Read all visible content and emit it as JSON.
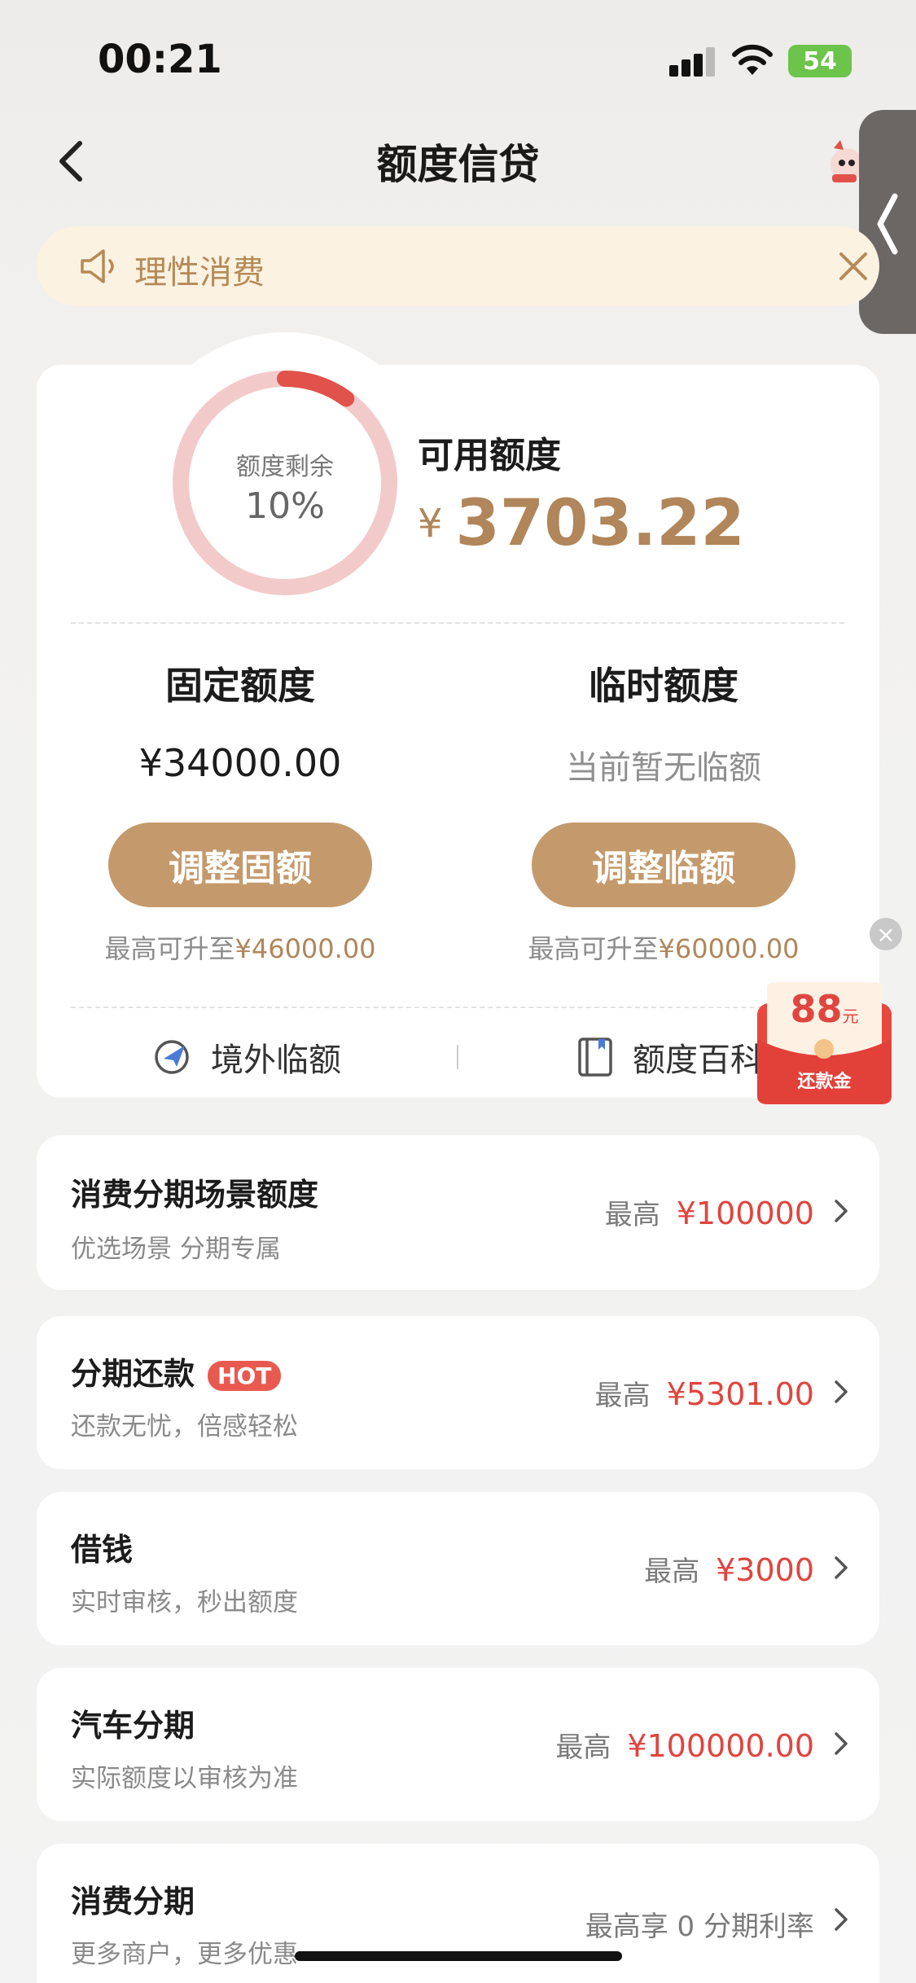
{
  "status_bar": {
    "time": "00:21",
    "battery": "54"
  },
  "nav": {
    "title": "额度信贷"
  },
  "notice": {
    "text": "理性消费"
  },
  "credit_card": {
    "ring_label": "额度剩余",
    "ring_value": "10%",
    "ring_fraction": 0.1,
    "available_label": "可用额度",
    "currency": "¥",
    "available_amount": "3703.22",
    "fixed": {
      "title": "固定额度",
      "value": "¥34000.00",
      "button": "调整固额",
      "hint_prefix": "最高可升至",
      "hint_amount": "¥46000.00"
    },
    "temporary": {
      "title": "临时额度",
      "value": "当前暂无临额",
      "button": "调整临额",
      "hint_prefix": "最高可升至",
      "hint_amount": "¥60000.00"
    },
    "footer_left": "境外临额",
    "footer_right": "额度百科"
  },
  "red_packet": {
    "amount": "88",
    "unit": "元",
    "label": "还款金"
  },
  "list_items": [
    {
      "title": "消费分期场景额度",
      "sub": "优选场景 分期专属",
      "prefix": "最高",
      "amount": "¥100000"
    },
    {
      "title": "分期还款",
      "badge": "HOT",
      "sub": "还款无忧，倍感轻松",
      "prefix": "最高",
      "amount": "¥5301.00"
    },
    {
      "title": "借钱",
      "sub": "实时审核，秒出额度",
      "prefix": "最高",
      "amount": "¥3000"
    },
    {
      "title": "汽车分期",
      "sub": "实际额度以审核为准",
      "prefix": "最高",
      "amount": "¥100000.00"
    },
    {
      "title": "消费分期",
      "sub": "更多商户，更多优惠",
      "prefix": "最高享 0 分期利率",
      "amount": ""
    }
  ],
  "colors": {
    "accent_gold": "#c49a6c",
    "amount_red": "#e0453f",
    "ring_red": "#e0524a",
    "ring_track": "#f3caca"
  },
  "icons": [
    "back-icon",
    "speaker-icon",
    "close-icon",
    "plane-icon",
    "book-icon",
    "chevron-right-icon",
    "mascot-icon"
  ]
}
